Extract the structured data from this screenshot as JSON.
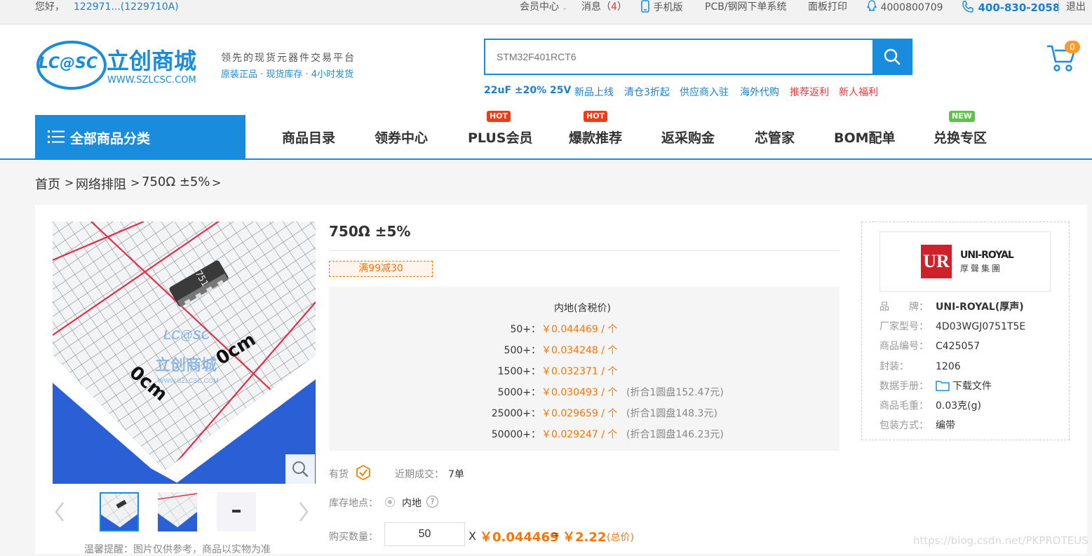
{
  "topbar": {
    "greeting": "您好，",
    "user": "122971...(1229710A)",
    "member_center": "会员中心",
    "messages_label": "消息（",
    "messages_count": "4",
    "messages_close": "）",
    "mobile": "手机版",
    "pcb": "PCB/钢网下单系统",
    "panel_print": "面板打印",
    "qq": "4000800709",
    "phone": "400-830-2058",
    "logout": "退出"
  },
  "logo": {
    "mark": "LC@SC",
    "name": "立创商城",
    "url": "WWW.SZLCSC.COM",
    "slogan1": "领先的现货元器件交易平台",
    "slogan2": "原装正品 · 现货库存 · 4小时发货"
  },
  "search": {
    "placeholder": "STM32F401RCT6"
  },
  "cart": {
    "count": "0"
  },
  "hotlinks": {
    "promo": "22uF ±20% 25V",
    "new_products": "新品上线",
    "clearance": "清仓3折起",
    "supplier": "供应商入驻",
    "overseas": "海外代购",
    "rebate": "推荐返利",
    "newcomer": "新人福利"
  },
  "nav": {
    "all_categories": "全部商品分类",
    "catalog": "商品目录",
    "coupons": "领券中心",
    "plus": "PLUS会员",
    "hot_items": "爆款推荐",
    "cashback": "返采购金",
    "chip_manager": "芯管家",
    "bom": "BOM配单",
    "exchange": "兑换专区",
    "hot_badge": "HOT",
    "new_badge": "NEW"
  },
  "breadcrumb": {
    "home": "首页",
    "sep": ">",
    "category": "网络排阻",
    "current": "750Ω ±5%",
    "more": ">"
  },
  "gallery": {
    "chip_marking": "751",
    "watermark_logo": "LC@SC",
    "watermark_name": "立创商城",
    "watermark_url": "WWW.SZLCSC.COM",
    "scale_label": "0cm",
    "tip": "温馨提醒：图片仅供参考，商品以实物为准"
  },
  "product": {
    "title": "750Ω ±5%",
    "promo_tag": "满99减30",
    "price_header": "内地(含税价)",
    "tiers": [
      {
        "qty": "50+：",
        "price": "￥0.044469 / 个",
        "note": ""
      },
      {
        "qty": "500+：",
        "price": "￥0.034248 / 个",
        "note": ""
      },
      {
        "qty": "1500+：",
        "price": "￥0.032371 / 个",
        "note": ""
      },
      {
        "qty": "5000+：",
        "price": "￥0.030493 / 个",
        "note": "(折合1圆盘152.47元)"
      },
      {
        "qty": "25000+：",
        "price": "￥0.029659 / 个",
        "note": "(折合1圆盘148.3元)"
      },
      {
        "qty": "50000+：",
        "price": "￥0.029247 / 个",
        "note": "(折合1圆盘146.23元)"
      }
    ],
    "stock_label": "有货",
    "recent_label": "近期成交：",
    "recent_value": "7单",
    "location_label": "库存地点：",
    "location_value": "内地",
    "help": "?",
    "qty_label": "购买数量：",
    "qty_value": "50",
    "times": "X",
    "unit_price": "￥0.044469",
    "equals": "=",
    "total": "￥2.22",
    "total_label": "(总价)"
  },
  "specs": {
    "brand_logo_mark": "UR",
    "brand_logo_name": "UNI-ROYAL",
    "brand_logo_cn": "厚聲集團",
    "rows": [
      {
        "k": "品　　牌：",
        "v": "UNI-ROYAL(厚声)"
      },
      {
        "k": "厂家型号：",
        "v": "4D03WGJ0751T5E"
      },
      {
        "k": "商品编号：",
        "v": "C425057"
      },
      {
        "k": "封装：",
        "v": "1206"
      },
      {
        "k": "数据手册：",
        "v": "下载文件"
      },
      {
        "k": "商品毛重：",
        "v": "0.03克(g)"
      },
      {
        "k": "包装方式：",
        "v": "编带"
      }
    ]
  },
  "watermark": "https://blog.csdn.net/PKPROTEUS"
}
